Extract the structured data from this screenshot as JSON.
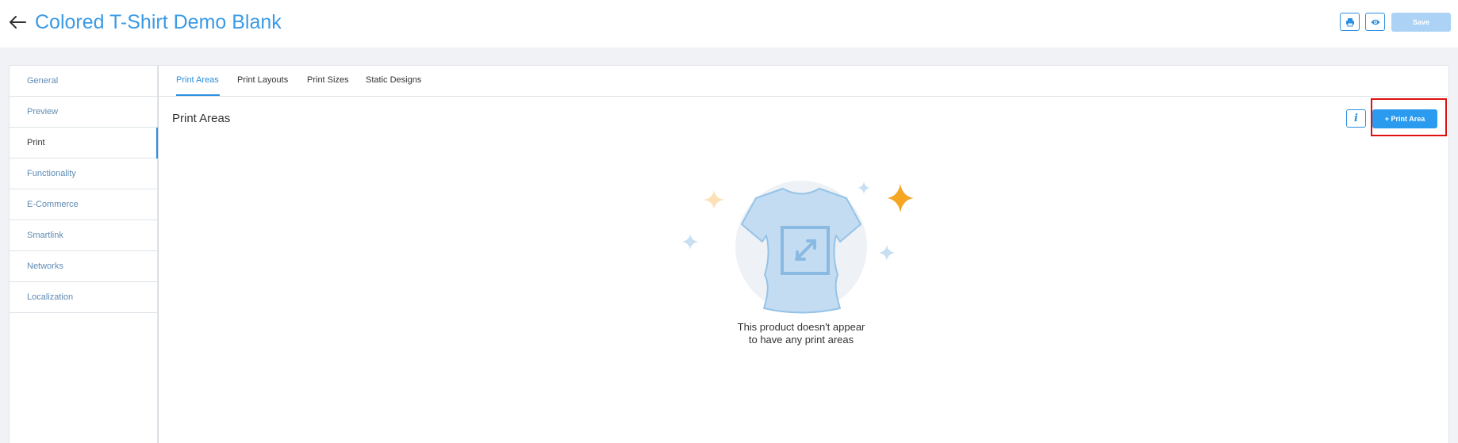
{
  "header": {
    "back_icon": "arrow-left-icon",
    "title": "Colored T-Shirt Demo Blank",
    "print_icon": "printer-icon",
    "preview_icon": "eye-icon",
    "save_label": "Save",
    "save_color": "#acd3f5"
  },
  "sidebar": {
    "items": [
      {
        "label": "General"
      },
      {
        "label": "Preview"
      },
      {
        "label": "Print"
      },
      {
        "label": "Functionality"
      },
      {
        "label": "E-Commerce"
      },
      {
        "label": "Smartlink"
      },
      {
        "label": "Networks"
      },
      {
        "label": "Localization"
      }
    ],
    "active": "Print"
  },
  "tabs": {
    "items": [
      {
        "label": "Print Areas"
      },
      {
        "label": "Print Layouts"
      },
      {
        "label": "Print Sizes"
      },
      {
        "label": "Static Designs"
      }
    ],
    "active": "Print Areas"
  },
  "section": {
    "title": "Print Areas",
    "info_label": "i",
    "add_label": "+ Print Area",
    "add_color": "#2b9bf0"
  },
  "empty_state": {
    "line1": "This product doesn't appear",
    "line2": "to have any print areas",
    "illustration_icon": "t-shirt-expand-icon"
  },
  "colors": {
    "accent": "#2d8fe0",
    "title": "#3a9ae6",
    "highlight": "#e01010"
  }
}
